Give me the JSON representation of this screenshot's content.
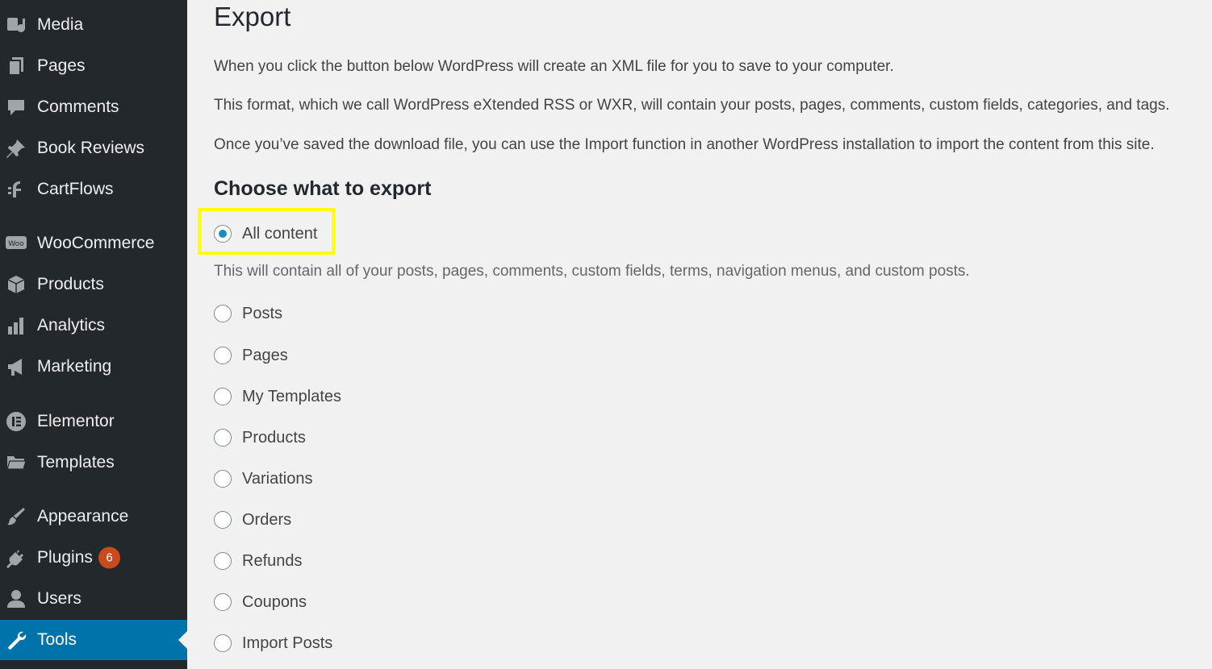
{
  "sidebar": {
    "items": [
      {
        "label": "Media",
        "icon": "media-icon"
      },
      {
        "label": "Pages",
        "icon": "pages-icon"
      },
      {
        "label": "Comments",
        "icon": "comments-icon"
      },
      {
        "label": "Book Reviews",
        "icon": "pin-icon"
      },
      {
        "label": "CartFlows",
        "icon": "cartflows-icon"
      },
      {
        "label": "WooCommerce",
        "icon": "woo-icon"
      },
      {
        "label": "Products",
        "icon": "box-icon"
      },
      {
        "label": "Analytics",
        "icon": "bar-chart-icon"
      },
      {
        "label": "Marketing",
        "icon": "megaphone-icon"
      },
      {
        "label": "Elementor",
        "icon": "elementor-icon"
      },
      {
        "label": "Templates",
        "icon": "folder-icon"
      },
      {
        "label": "Appearance",
        "icon": "brush-icon"
      },
      {
        "label": "Plugins",
        "icon": "plug-icon",
        "badge": "6"
      },
      {
        "label": "Users",
        "icon": "user-icon"
      },
      {
        "label": "Tools",
        "icon": "wrench-icon",
        "active": true
      }
    ]
  },
  "main": {
    "title": "Export",
    "paragraphs": [
      "When you click the button below WordPress will create an XML file for you to save to your computer.",
      "This format, which we call WordPress eXtended RSS or WXR, will contain your posts, pages, comments, custom fields, categories, and tags.",
      "Once you’ve saved the download file, you can use the Import function in another WordPress installation to import the content from this site."
    ],
    "section_title": "Choose what to export",
    "all_content_desc": "This will contain all of your posts, pages, comments, custom fields, terms, navigation menus, and custom posts.",
    "options": [
      {
        "label": "All content",
        "checked": true
      },
      {
        "label": "Posts",
        "checked": false
      },
      {
        "label": "Pages",
        "checked": false
      },
      {
        "label": "My Templates",
        "checked": false
      },
      {
        "label": "Products",
        "checked": false
      },
      {
        "label": "Variations",
        "checked": false
      },
      {
        "label": "Orders",
        "checked": false
      },
      {
        "label": "Refunds",
        "checked": false
      },
      {
        "label": "Coupons",
        "checked": false
      },
      {
        "label": "Import Posts",
        "checked": false
      }
    ]
  },
  "colors": {
    "sidebar_bg": "#23282d",
    "active_bg": "#0073aa",
    "badge_bg": "#ca4a1f",
    "highlight": "#ffff00",
    "radio_checked": "#1e8cbe"
  }
}
